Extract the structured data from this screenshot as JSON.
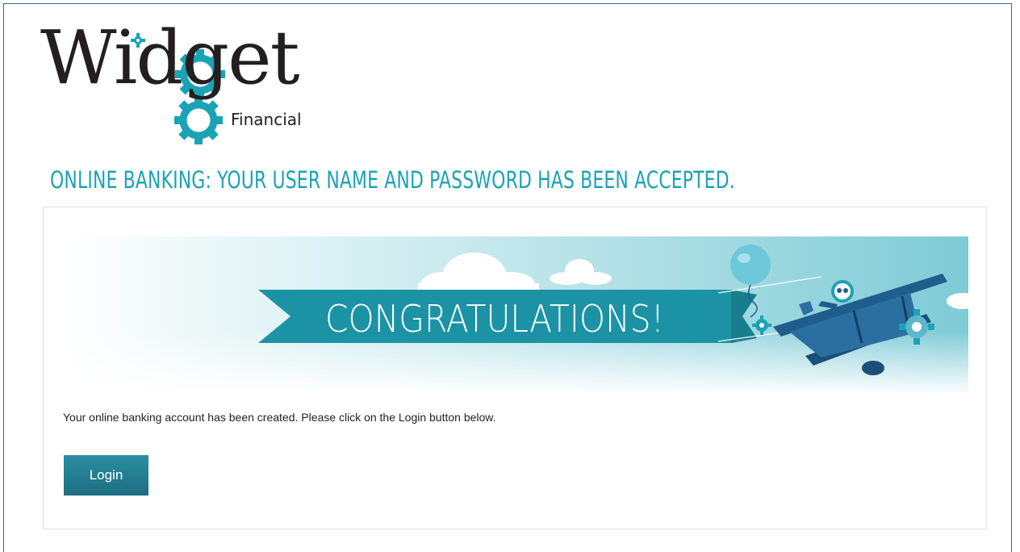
{
  "logo": {
    "word": "Widget",
    "sub": "Financial"
  },
  "headline": "ONLINE BANKING: YOUR USER NAME AND PASSWORD HAS BEEN ACCEPTED.",
  "banner": {
    "text": "CONGRATULATIONS!"
  },
  "message": "Your online banking account has been created. Please click on the Login button below.",
  "login_button": "Login",
  "colors": {
    "accent": "#1aa3b6",
    "button": "#1d6e80",
    "ribbon": "#1c93a5",
    "plane": "#1f5d8c"
  }
}
